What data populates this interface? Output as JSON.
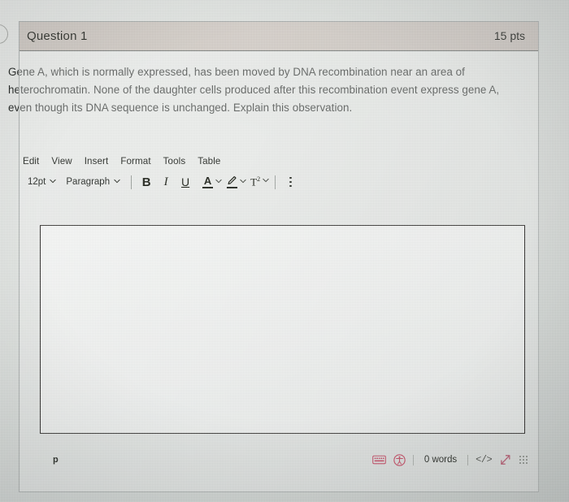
{
  "question": {
    "title": "Question 1",
    "points": "15 pts",
    "prompt": "Gene A, which is normally expressed, has been moved by DNA recombination near an area of heterochromatin. None of the daughter cells produced after this recombination event express gene A, even though its DNA sequence is unchanged. Explain this observation."
  },
  "editor": {
    "menubar": [
      {
        "label": "Edit"
      },
      {
        "label": "View"
      },
      {
        "label": "Insert"
      },
      {
        "label": "Format"
      },
      {
        "label": "Tools"
      },
      {
        "label": "Table"
      }
    ],
    "toolbar": {
      "font_size": "12pt",
      "block_format": "Paragraph",
      "bold": "B",
      "italic": "I",
      "underline": "U",
      "text_color": "A",
      "highlight_color": "✎",
      "superscript": "T",
      "superscript_exponent": "2",
      "more_label": "⋮"
    },
    "content": "",
    "statusbar": {
      "element_path": "p",
      "word_count": "0 words",
      "code_view": "</>",
      "keyboard_icon": "keyboard-icon",
      "accessibility_icon": "accessibility-icon",
      "fullscreen_icon": "resize-arrows-icon",
      "resize_grip_icon": "resize-grip-icon"
    }
  },
  "colors": {
    "header_bg": "#cdc7c1",
    "page_bg": "#dadedb",
    "status_icon_accent": "#c24a63",
    "content_border": "#2c2a28"
  }
}
